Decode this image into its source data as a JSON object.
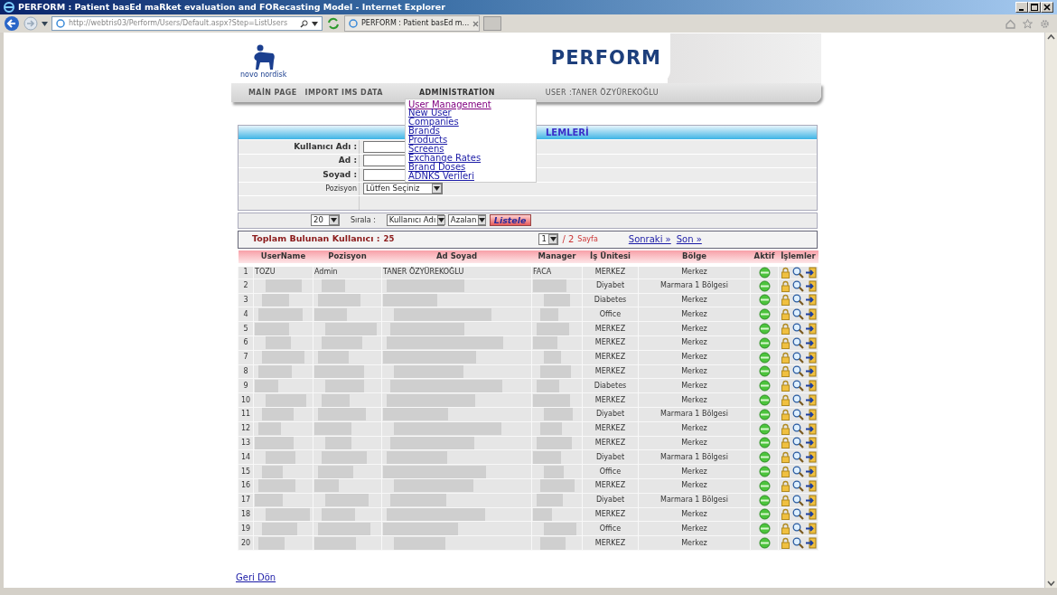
{
  "window": {
    "title": "PERFORM : Patient basEd maRket evaluation and FORecasting Model - Internet Explorer"
  },
  "browser": {
    "address": "http://webtris03/Perform/Users/Default.aspx?Step=ListUsers",
    "tab": "PERFORM : Patient basEd m..."
  },
  "header": {
    "logo": "novo nordisk",
    "brand": "PERFORM"
  },
  "nav": [
    {
      "label": "MAİN PAGE",
      "open": false
    },
    {
      "label": "IMPORT IMS DATA",
      "open": false
    },
    {
      "label": "ADMİNİSTRATİON",
      "open": true
    }
  ],
  "user": "USER :TANER ÖZYÜREKOĞLU",
  "menu": [
    {
      "label": "User Management",
      "visited": true
    },
    {
      "label": "New User",
      "visited": false
    },
    {
      "label": "Companies",
      "visited": false
    },
    {
      "label": "Brands",
      "visited": false
    },
    {
      "label": "Products",
      "visited": false
    },
    {
      "label": "Screens",
      "visited": false
    },
    {
      "label": "Exchange Rates",
      "visited": false
    },
    {
      "label": "Brand Doses",
      "visited": false
    },
    {
      "label": "ADNKS Verileri",
      "visited": false
    }
  ],
  "form": {
    "heading": "LEMLERİ",
    "fields": [
      {
        "label": "Kullanıcı Adı :",
        "kind": "text"
      },
      {
        "label": "Ad :",
        "kind": "text"
      },
      {
        "label": "Soyad :",
        "kind": "text"
      },
      {
        "label": "Pozisyon",
        "kind": "select",
        "value": "Lütfen Seçiniz"
      }
    ]
  },
  "toolbar": {
    "page_size": "20",
    "sort_label": "Sırala :",
    "sort_by": "Kullanıcı Adı",
    "order": "Azalan",
    "button": "Listele"
  },
  "summary": {
    "label": "Toplam Bulunan Kullanıcı :",
    "count": "25",
    "page": "1",
    "pages": "/ 2",
    "unit": "Sayfa",
    "links": [
      "Sonraki »",
      "Son »"
    ]
  },
  "table": {
    "columns": [
      "UserName",
      "Pozisyon",
      "Ad Soyad",
      "Manager",
      "İş Ünitesi",
      "Bölge",
      "Aktif",
      "İşlemler"
    ],
    "rows": [
      {
        "no": "1",
        "redacted": false,
        "username": "TOZU",
        "position": "Admin",
        "name": "TANER ÖZYÜREKOĞLU",
        "manager": "FACA",
        "unit": "MERKEZ",
        "region": "Merkez",
        "active": true
      },
      {
        "no": "2",
        "redacted": true,
        "unit": "Diyabet",
        "region": "Marmara 1 Bölgesi",
        "active": true
      },
      {
        "no": "3",
        "redacted": true,
        "unit": "Diabetes",
        "region": "Merkez",
        "active": true
      },
      {
        "no": "4",
        "redacted": true,
        "unit": "Office",
        "region": "Merkez",
        "active": true
      },
      {
        "no": "5",
        "redacted": true,
        "unit": "MERKEZ",
        "region": "Merkez",
        "active": true
      },
      {
        "no": "6",
        "redacted": true,
        "unit": "MERKEZ",
        "region": "Merkez",
        "active": true
      },
      {
        "no": "7",
        "redacted": true,
        "unit": "MERKEZ",
        "region": "Merkez",
        "active": true
      },
      {
        "no": "8",
        "redacted": true,
        "unit": "MERKEZ",
        "region": "Merkez",
        "active": true
      },
      {
        "no": "9",
        "redacted": true,
        "unit": "Diabetes",
        "region": "Merkez",
        "active": true
      },
      {
        "no": "10",
        "redacted": true,
        "unit": "MERKEZ",
        "region": "Merkez",
        "active": true
      },
      {
        "no": "11",
        "redacted": true,
        "unit": "Diyabet",
        "region": "Marmara 1 Bölgesi",
        "active": true
      },
      {
        "no": "12",
        "redacted": true,
        "unit": "MERKEZ",
        "region": "Merkez",
        "active": true
      },
      {
        "no": "13",
        "redacted": true,
        "unit": "MERKEZ",
        "region": "Merkez",
        "active": true
      },
      {
        "no": "14",
        "redacted": true,
        "unit": "Diyabet",
        "region": "Marmara 1 Bölgesi",
        "active": true
      },
      {
        "no": "15",
        "redacted": true,
        "unit": "Office",
        "region": "Merkez",
        "active": true
      },
      {
        "no": "16",
        "redacted": true,
        "unit": "MERKEZ",
        "region": "Merkez",
        "active": true
      },
      {
        "no": "17",
        "redacted": true,
        "unit": "Diyabet",
        "region": "Marmara 1 Bölgesi",
        "active": true
      },
      {
        "no": "18",
        "redacted": true,
        "unit": "MERKEZ",
        "region": "Merkez",
        "active": true
      },
      {
        "no": "19",
        "redacted": true,
        "unit": "Office",
        "region": "Merkez",
        "active": true
      },
      {
        "no": "20",
        "redacted": true,
        "unit": "MERKEZ",
        "region": "Merkez",
        "active": true
      }
    ]
  },
  "back_link": "Geri Dön"
}
